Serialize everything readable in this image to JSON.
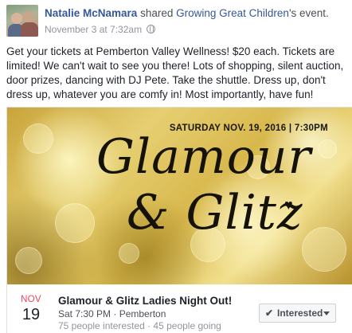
{
  "post": {
    "author": "Natalie McNamara",
    "action": "shared",
    "shared_page": "Growing Great Children",
    "shared_suffix": "'s event.",
    "timestamp": "November 3 at 7:32am",
    "privacy_icon": "globe-icon",
    "body": "Get your tickets at Pemberton Valley Wellness! $20 each. Tickets are limited! We can't wait to see you there! Lots of shopping, silent auction, door prizes, dancing with DJ Pete. Take the shuttle. Dress up, don't dress up, whatever you are comfy in! Most importantly, have fun!"
  },
  "event": {
    "banner": {
      "date_line": "SATURDAY NOV. 19, 2016 | 7:30PM",
      "title_line1": "Glamour",
      "title_line2": "& Glitz",
      "heart_icon": "heart-icon"
    },
    "month": "NOV",
    "day": "19",
    "title": "Glamour & Glitz Ladies Night Out!",
    "time_location": "Sat 7:30 PM · Pemberton",
    "stats": "75 people interested · 45 people going",
    "button_label": "Interested",
    "button_icon": "check-icon",
    "colors": {
      "link": "#365899",
      "month": "#f3425f",
      "meta": "#90949c"
    }
  }
}
